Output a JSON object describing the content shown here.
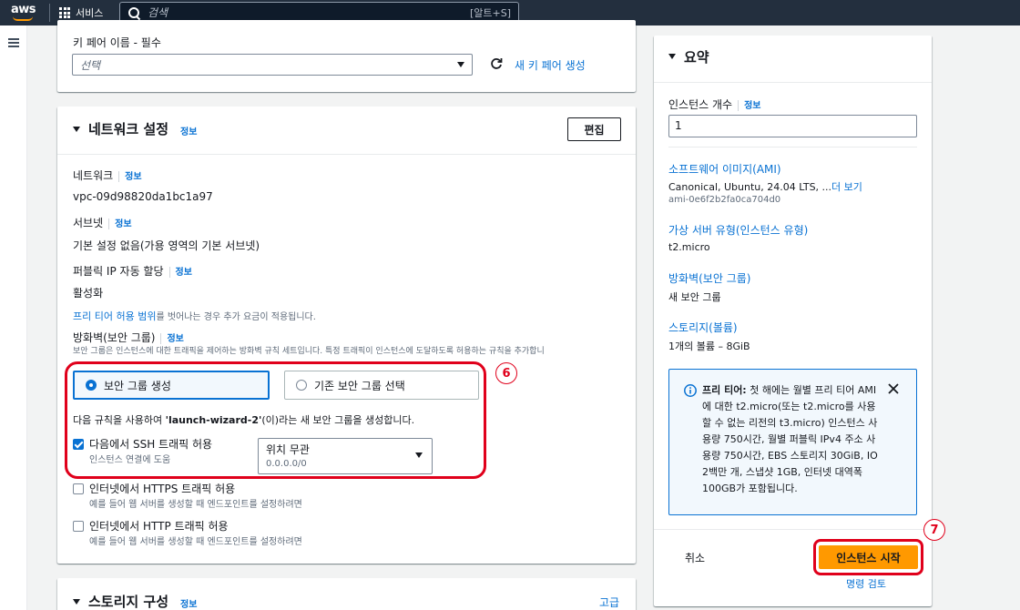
{
  "nav": {
    "logo": "aws",
    "services_label": "서비스",
    "search_placeholder": "검색",
    "search_shortcut": "[알트+S]"
  },
  "key_pair": {
    "label": "키 페어 이름 - 필수",
    "select_placeholder": "선택",
    "new_key_link": "새 키 페어 생성"
  },
  "network": {
    "title": "네트워크 설정",
    "info": "정보",
    "edit_button": "편집",
    "network_label": "네트워크",
    "network_value": "vpc-09d98820da1bc1a97",
    "subnet_label": "서브넷",
    "subnet_value": "기본 설정 없음(가용 영역의 기본 서브넷)",
    "public_ip_label": "퍼블릭 IP 자동 할당",
    "public_ip_value": "활성화",
    "free_tier_note_link": "프리 티어 허용 범위",
    "free_tier_note_rest": "를 벗어나는 경우 추가 요금이 적용됩니다.",
    "firewall_label": "방화벽(보안 그룹)",
    "firewall_desc": "보안 그룹은 인스턴스에 대한 트래픽을 제어하는 방화벽 규칙 세트입니다. 특정 트래픽이 인스턴스에 도달하도록 허용하는 규칙을 추가합니",
    "create_sg": "보안 그룹 생성",
    "existing_sg": "기존 보안 그룹 선택",
    "rule_text_before": "다음 규칙을 사용하여 ",
    "rule_text_name": "'launch-wizard-2'",
    "rule_text_after": "(이)라는 새 보안 그룹을 생성합니다.",
    "ssh_label": "다음에서 SSH 트래픽 허용",
    "ssh_desc": "인스턴스 연결에 도움",
    "ssh_source": "위치 무관",
    "ssh_cidr": "0.0.0.0/0",
    "https_label": "인터넷에서 HTTPS 트래픽 허용",
    "https_desc": "예를 들어 웹 서버를 생성할 때 엔드포인트를 설정하려면",
    "http_label": "인터넷에서 HTTP 트래픽 허용",
    "http_desc": "예를 들어 웹 서버를 생성할 때 엔드포인트를 설정하려면",
    "annotation_6": "6"
  },
  "storage": {
    "title": "스토리지 구성",
    "info": "정보",
    "advanced": "고급"
  },
  "summary": {
    "title": "요약",
    "instance_count_label": "인스턴스 개수",
    "info": "정보",
    "instance_count_value": "1",
    "ami_label": "소프트웨어 이미지(AMI)",
    "ami_value": "Canonical, Ubuntu, 24.04 LTS, ...",
    "ami_more": "더 보기",
    "ami_id": "ami-0e6f2b2fa0ca704d0",
    "type_label": "가상 서버 유형(인스턴스 유형)",
    "type_value": "t2.micro",
    "firewall_label": "방화벽(보안 그룹)",
    "firewall_value": "새 보안 그룹",
    "storage_label": "스토리지(볼륨)",
    "storage_value": "1개의 볼륨 – 8GiB",
    "free_tier_bold": "프리 티어:",
    "free_tier_text": " 첫 해에는 월별 프리 티어 AMI에 대한 t2.micro(또는 t2.micro를 사용할 수 없는 리전의 t3.micro) 인스턴스 사용량 750시간, 월별 퍼블릭 IPv4 주소 사용량 750시간, EBS 스토리지 30GiB, IO 2백만 개, 스냅샷 1GB, 인터넷 대역폭 100GB가 포함됩니다.",
    "cancel": "취소",
    "launch": "인스턴스 시작",
    "review_commands": "명령 검토",
    "annotation_7": "7"
  },
  "colors": {
    "nav_bg": "#232f3e",
    "link": "#0972d3",
    "primary_button": "#ff9900",
    "annotation_red": "#e0001b"
  }
}
